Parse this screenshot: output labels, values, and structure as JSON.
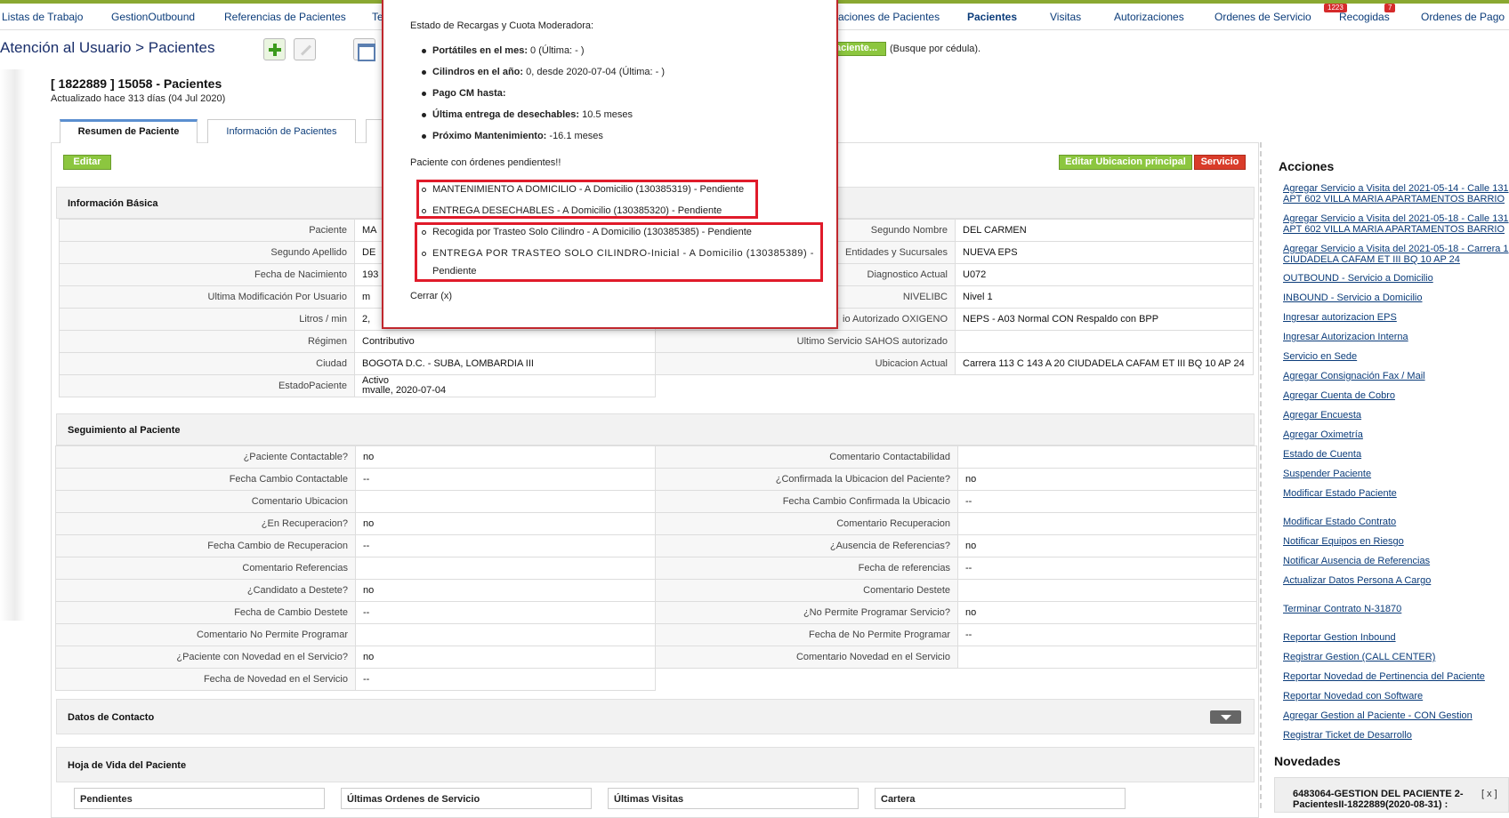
{
  "topnav": {
    "items": [
      "Listas de Trabajo",
      "GestionOutbound",
      "Referencias de Pacientes",
      "Te",
      "aciones de Pacientes",
      "Pacientes",
      "Visitas",
      "Autorizaciones",
      "Ordenes de Servicio",
      "Recogidas",
      "Ordenes de Pago"
    ],
    "badges": [
      "1223",
      "7"
    ]
  },
  "breadcrumb": "Atención al Usuario > Pacientes",
  "search": {
    "button_label": "aciente...",
    "hint": "(Busque por cédula)."
  },
  "patient": {
    "title": "[ 1822889 ] 15058 - Pacientes",
    "updated": "Actualizado hace 313 días (04 Jul 2020)"
  },
  "tabs": [
    "Resumen de Paciente",
    "Información de Pacientes",
    ""
  ],
  "buttons": {
    "edit": "Editar",
    "edit_location": "Editar Ubicacion principal",
    "service": "Servicio"
  },
  "basic": {
    "title": "Información Básica",
    "left": [
      {
        "label": "Paciente",
        "value": "MA"
      },
      {
        "label": "Segundo Apellido",
        "value": "DE"
      },
      {
        "label": "Fecha de Nacimiento",
        "value": "193"
      },
      {
        "label": "Ultima Modificación Por Usuario",
        "value": "m"
      },
      {
        "label": "Litros / min",
        "value": "2,"
      },
      {
        "label": "Régimen",
        "value": "Contributivo"
      },
      {
        "label": "Ciudad",
        "value": "BOGOTA D.C. - SUBA, LOMBARDIA III"
      },
      {
        "label": "EstadoPaciente",
        "value": "Activo\nmvalle, 2020-07-04"
      }
    ],
    "right": [
      {
        "label": "Segundo Nombre",
        "value": "DEL CARMEN"
      },
      {
        "label": "Entidades y Sucursales",
        "value": "NUEVA EPS"
      },
      {
        "label": "Diagnostico Actual",
        "value": "U072"
      },
      {
        "label": "NIVELIBC",
        "value": "Nivel 1"
      },
      {
        "label": "io Autorizado OXIGENO",
        "value": "NEPS - A03 Normal CON Respaldo con BPP"
      },
      {
        "label": "Ultimo Servicio SAHOS autorizado",
        "value": ""
      },
      {
        "label": "Ubicacion Actual",
        "value": "Carrera 113 C 143 A 20 CIUDADELA CAFAM ET III BQ 10 AP 24"
      }
    ]
  },
  "seguimiento": {
    "title": "Seguimiento al Paciente",
    "left": [
      {
        "label": "¿Paciente Contactable?",
        "value": "no"
      },
      {
        "label": "Fecha Cambio Contactable",
        "value": "--"
      },
      {
        "label": "Comentario Ubicacion",
        "value": ""
      },
      {
        "label": "¿En Recuperacion?",
        "value": "no"
      },
      {
        "label": "Fecha Cambio de Recuperacion",
        "value": "--"
      },
      {
        "label": "Comentario Referencias",
        "value": ""
      },
      {
        "label": "¿Candidato a Destete?",
        "value": "no"
      },
      {
        "label": "Fecha de Cambio Destete",
        "value": "--"
      },
      {
        "label": "Comentario No Permite Programar",
        "value": ""
      },
      {
        "label": "¿Paciente con Novedad en el Servicio?",
        "value": "no"
      },
      {
        "label": "Fecha de Novedad en el Servicio",
        "value": "--"
      }
    ],
    "right": [
      {
        "label": "Comentario Contactabilidad",
        "value": ""
      },
      {
        "label": "¿Confirmada la Ubicacion del Paciente?",
        "value": "no"
      },
      {
        "label": "Fecha Cambio Confirmada la Ubicacio",
        "value": "--"
      },
      {
        "label": "Comentario Recuperacion",
        "value": ""
      },
      {
        "label": "¿Ausencia de Referencias?",
        "value": "no"
      },
      {
        "label": "Fecha de referencias",
        "value": "--"
      },
      {
        "label": "Comentario Destete",
        "value": ""
      },
      {
        "label": "¿No Permite Programar Servicio?",
        "value": "no"
      },
      {
        "label": "Fecha de No Permite Programar",
        "value": "--"
      },
      {
        "label": "Comentario Novedad en el Servicio",
        "value": ""
      }
    ]
  },
  "contacto": {
    "title": "Datos de Contacto"
  },
  "hoja": {
    "title": "Hoja de Vida del Paciente",
    "columns": [
      "Pendientes",
      "Últimas Ordenes de Servicio",
      "Últimas Visitas",
      "Cartera"
    ]
  },
  "acciones": {
    "title": "Acciones",
    "links": [
      "Agregar Servicio a Visita del 2021-05-14 - Calle 131",
      "APT 602 VILLA MARIA APARTAMENTOS BARRIO",
      "Agregar Servicio a Visita del 2021-05-18 - Calle 131",
      "APT 602 VILLA MARIA APARTAMENTOS BARRIO",
      "Agregar Servicio a Visita del 2021-05-18 - Carrera 1",
      "CIUDADELA CAFAM ET III BQ 10 AP 24",
      "OUTBOUND - Servicio a Domicilio",
      "INBOUND - Servicio a Domicilio",
      "Ingresar autorizacion EPS",
      "Ingresar Autorizacion Interna",
      "Servicio en Sede",
      "Agregar Consignación Fax / Mail",
      "Agregar Cuenta de Cobro",
      "Agregar Encuesta",
      "Agregar Oximetría",
      "Estado de Cuenta",
      "Suspender Paciente",
      "Modificar Estado Paciente",
      "Modificar Estado Contrato",
      "Notificar Equipos en Riesgo",
      "Notificar Ausencia de Referencias",
      "Actualizar Datos Persona A Cargo",
      "Terminar Contrato N-31870",
      "Reportar Gestion Inbound",
      "Registrar Gestion (CALL CENTER)",
      "Reportar Novedad de Pertinencia del Paciente",
      "Reportar Novedad con Software",
      "Agregar Gestion al Paciente - CON Gestion",
      "Registrar Ticket de Desarrollo"
    ]
  },
  "novedades": {
    "title": "Novedades",
    "item": "6483064-GESTION DEL PACIENTE 2-PacientesII-1822889(2020-08-31) :",
    "close": "[ x ]"
  },
  "modal": {
    "heading": "Estado de Recargas y Cuota Moderadora:",
    "items": [
      {
        "label": "Portátiles en el mes:",
        "value": " 0 (Última: - )"
      },
      {
        "label": "Cilindros en el año:",
        "value": " 0, desde 2020-07-04 (Última: - )"
      },
      {
        "label": "Pago CM hasta:",
        "value": ""
      },
      {
        "label": "Última entrega de desechables:",
        "value": " 10.5 meses"
      },
      {
        "label": "Próximo Mantenimiento:",
        "value": " -16.1 meses"
      }
    ],
    "pending_heading": "Paciente con órdenes pendientes!!",
    "orders": [
      "MANTENIMIENTO A DOMICILIO - A Domicilio (130385319) - Pendiente",
      "ENTREGA DESECHABLES - A Domicilio (130385320) - Pendiente",
      "Recogida por Trasteo Solo Cilindro - A Domicilio (130385385) - Pendiente",
      "ENTREGA POR TRASTEO SOLO CILINDRO-Inicial - A Domicilio (130385389) -",
      "Pendiente"
    ],
    "close": "Cerrar (x)"
  },
  "colors": {
    "accent_green": "#8cc63f",
    "alert_red": "#d93c2a",
    "highlight_red": "#e01b2a",
    "link_blue": "#0b3c7a"
  }
}
